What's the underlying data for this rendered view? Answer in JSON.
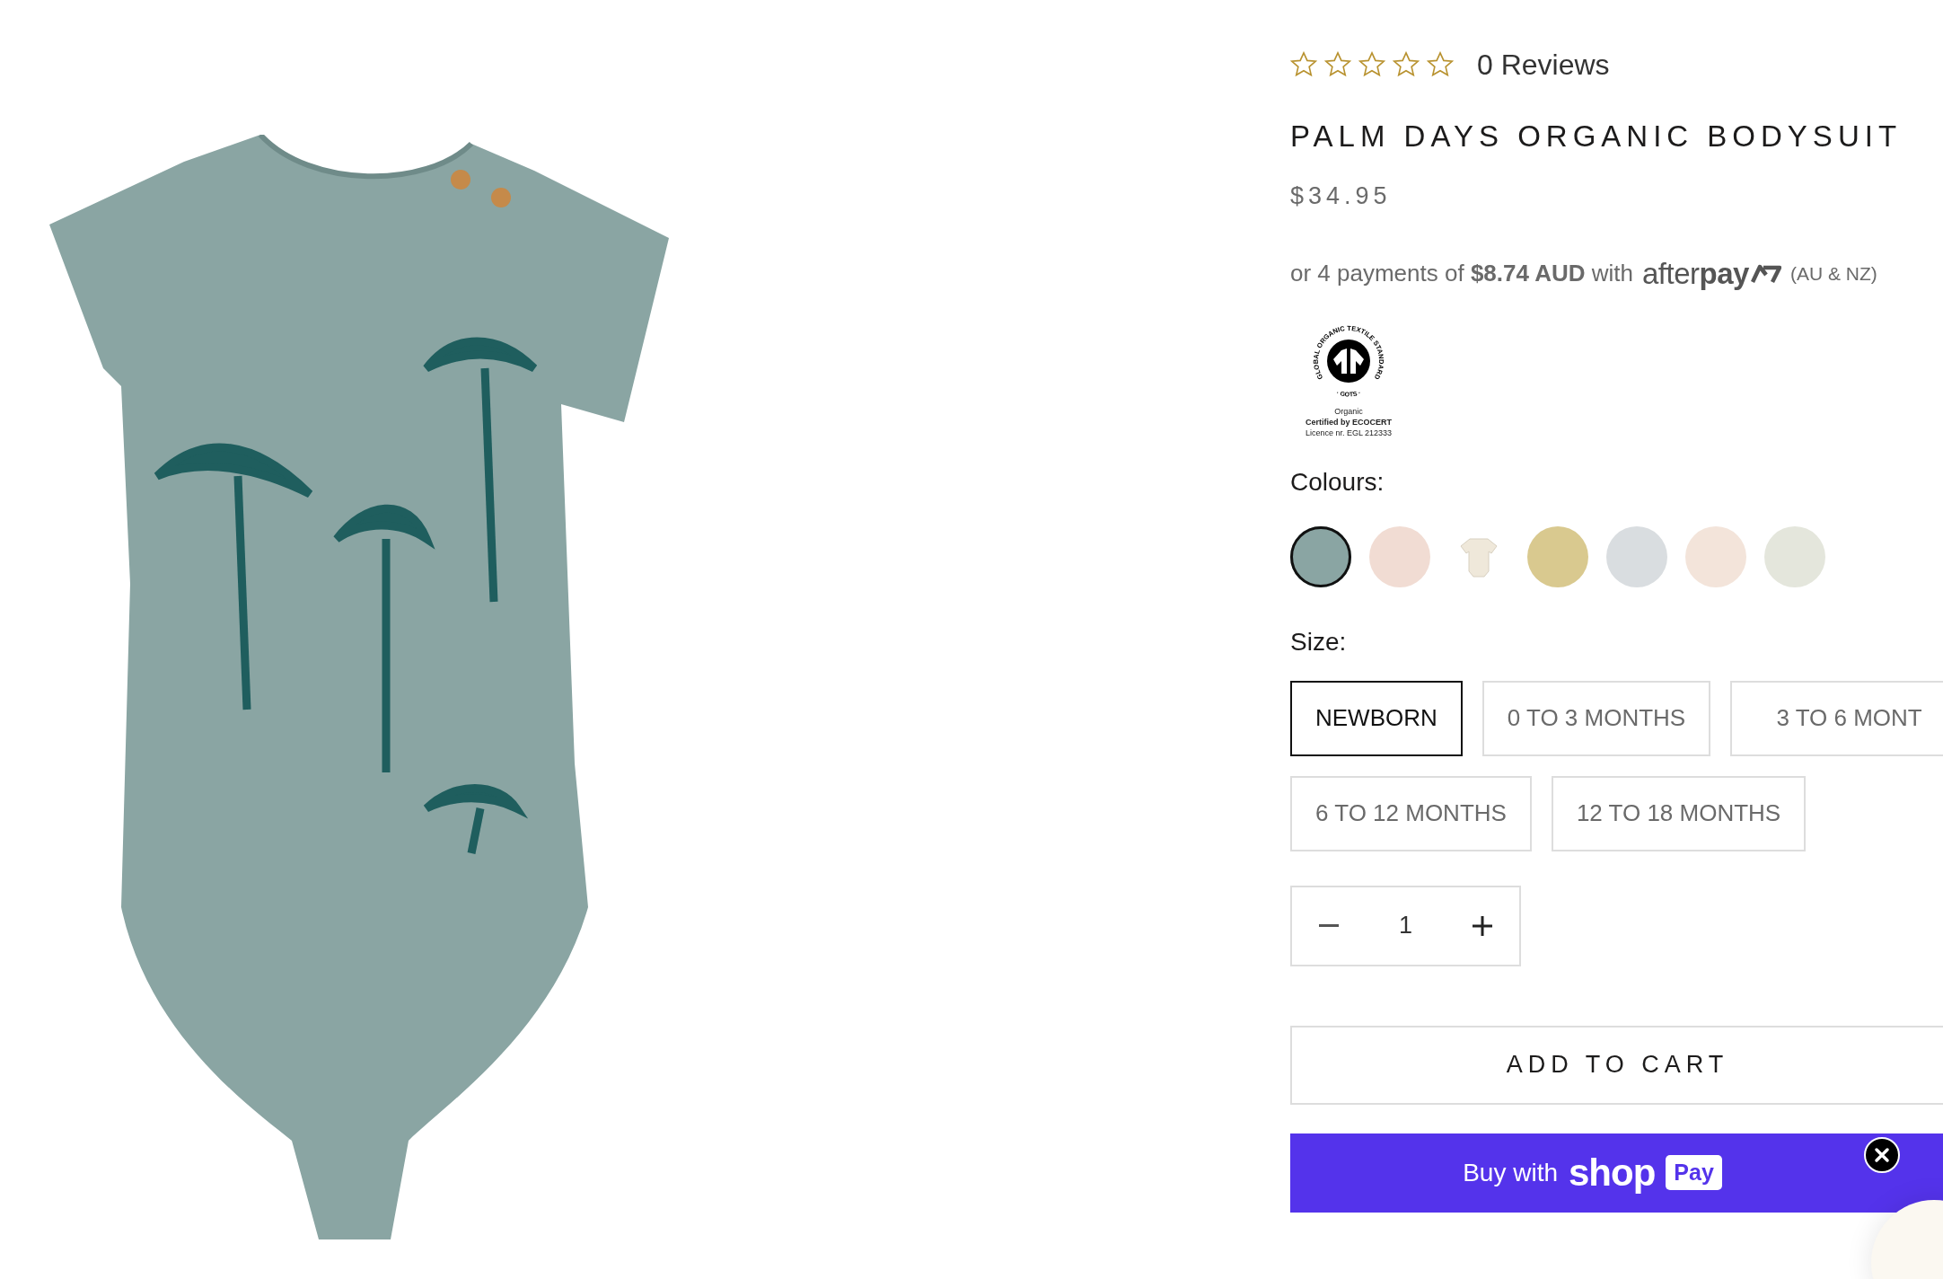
{
  "rating": {
    "stars": 0,
    "reviews": "0 Reviews"
  },
  "title": "PALM DAYS ORGANIC BODYSUIT",
  "price": "$34.95",
  "afterpay": {
    "text": "or 4 payments of **$8.74 AUD** with",
    "logo": "after**pay**",
    "region": "(AU & NZ)"
  },
  "certification": {
    "ring_text": "GLOBAL ORGANIC TEXTILE STANDARD",
    "short": "· GOTS ·",
    "lines": [
      "Organic",
      "**Certified by ECOCERT**",
      "Licence nr. EGL 212333"
    ]
  },
  "colours": {
    "label": "Colours:",
    "swatches": [
      {
        "kind": "pattern",
        "color": "#8aa5a3",
        "selected": true
      },
      {
        "kind": "pattern",
        "color": "#f1dcd3",
        "selected": false
      },
      {
        "kind": "garment",
        "color": "#efe8da",
        "selected": false
      },
      {
        "kind": "pattern",
        "color": "#d9c98f",
        "selected": false
      },
      {
        "kind": "pattern",
        "color": "#d9dde0",
        "selected": false
      },
      {
        "kind": "pattern",
        "color": "#f3e4da",
        "selected": false
      },
      {
        "kind": "pattern",
        "color": "#e4e6dc",
        "selected": false
      }
    ]
  },
  "size": {
    "label": "Size:",
    "options": [
      {
        "label": "NEWBORN",
        "selected": true
      },
      {
        "label": "0 TO 3 MONTHS",
        "selected": false
      },
      {
        "label": "3 TO 6 MONT",
        "selected": false
      },
      {
        "label": "6 TO 12 MONTHS",
        "selected": false
      },
      {
        "label": "12 TO 18 MONTHS",
        "selected": false
      }
    ]
  },
  "quantity": {
    "value": "1"
  },
  "add_to_cart": "ADD TO CART",
  "shop_pay": {
    "prefix": "Buy with",
    "brand": "shop",
    "badge": "Pay"
  }
}
